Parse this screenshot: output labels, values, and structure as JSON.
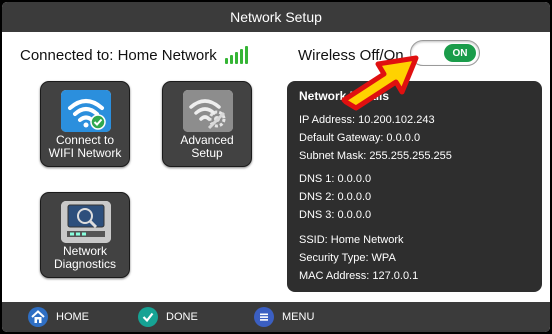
{
  "header": {
    "title": "Network Setup"
  },
  "connection": {
    "label": "Connected to: Home Network",
    "signal_bars": 5
  },
  "wireless": {
    "label": "Wireless Off/On",
    "toggle_state": "ON"
  },
  "tiles": [
    {
      "label_line1": "Connect to",
      "label_line2": "WIFI Network",
      "icon": "wifi-check-icon"
    },
    {
      "label_line1": "Advanced",
      "label_line2": "Setup",
      "icon": "wifi-gear-icon"
    },
    {
      "label_line1": "Network",
      "label_line2": "Diagnostics",
      "icon": "network-diagnostics-icon"
    }
  ],
  "details": {
    "title": "Network Details",
    "ip": "IP Address: 10.200.102.243",
    "gateway": "Default Gateway: 0.0.0.0",
    "subnet": "Subnet Mask: 255.255.255.255",
    "dns1": "DNS 1: 0.0.0.0",
    "dns2": "DNS 2: 0.0.0.0",
    "dns3": "DNS 3: 0.0.0.0",
    "ssid": "SSID: Home Network",
    "security": "Security Type: WPA",
    "mac": "MAC Address: 127.0.0.1"
  },
  "nav": {
    "home": "HOME",
    "done": "DONE",
    "menu": "MENU"
  },
  "colors": {
    "bar": "#3b3b3b",
    "tile": "#424242",
    "panel": "#2e2e2e",
    "toggle_on": "#1a9c4a",
    "signal": "#35b535",
    "arrow_red": "#e01010",
    "arrow_yellow": "#ffd200",
    "home_blue": "#2f6fc4",
    "done_teal": "#16a394",
    "menu_blue": "#3b5fc2"
  }
}
